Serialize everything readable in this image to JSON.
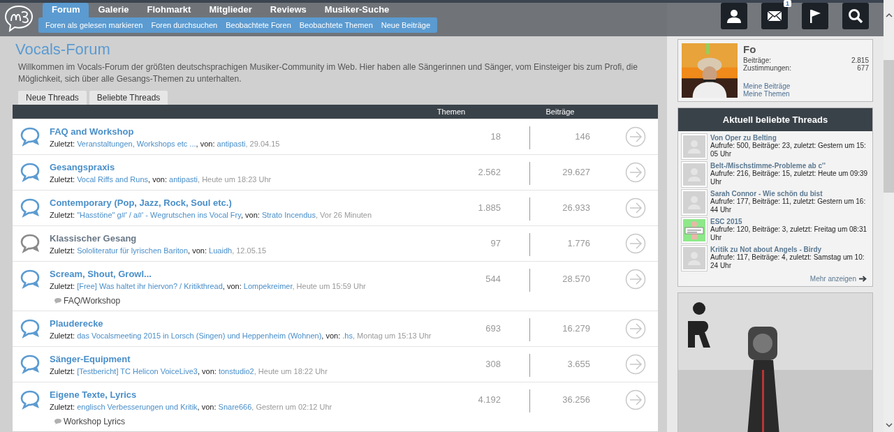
{
  "header": {
    "nav": [
      {
        "label": "Forum",
        "selected": true
      },
      {
        "label": "Galerie",
        "selected": false
      },
      {
        "label": "Flohmarkt",
        "selected": false
      },
      {
        "label": "Mitglieder",
        "selected": false
      },
      {
        "label": "Reviews",
        "selected": false
      },
      {
        "label": "Musiker-Suche",
        "selected": false
      }
    ],
    "subnav": [
      "Foren als gelesen markieren",
      "Foren durchsuchen",
      "Beobachtete Foren",
      "Beobachtete Themen",
      "Neue Beiträge"
    ],
    "mail_badge": "1"
  },
  "forum": {
    "title": "Vocals-Forum",
    "description": "Willkommen im Vocals-Forum der größten deutschsprachigen Musiker-Community im Web. Hier haben alle Sängerinnen und Sänger, vom Einsteiger bis zum Profi, die Möglichkeit, sich über alle Gesangs-Themen zu unterhalten.",
    "tabs": [
      {
        "label": "Neue Threads",
        "selected": false
      },
      {
        "label": "Beliebte Threads",
        "selected": false
      }
    ],
    "columns": [
      "Themen",
      "Beiträge"
    ],
    "rows": [
      {
        "title": "FAQ and Workshop",
        "unread": true,
        "last_post": [
          {
            "kind": "label",
            "text": "Zuletzt:"
          },
          {
            "kind": "thread",
            "text": "Veranstaltungen, Workshops etc ..."
          },
          {
            "kind": "label",
            "text": ", von:"
          },
          {
            "kind": "user",
            "text": "antipasti"
          },
          {
            "kind": "date",
            "text": ", 29.04.15"
          }
        ],
        "topics": "18",
        "posts": "146"
      },
      {
        "title": "Gesangspraxis",
        "unread": true,
        "last_post": [
          {
            "kind": "label",
            "text": "Zuletzt:"
          },
          {
            "kind": "thread",
            "text": "Vocal Riffs and Runs"
          },
          {
            "kind": "label",
            "text": ", von:"
          },
          {
            "kind": "user",
            "text": "antipasti"
          },
          {
            "kind": "date",
            "text": ", Heute um 18:23 Uhr"
          }
        ],
        "topics": "2.562",
        "posts": "29.627"
      },
      {
        "title": "Contemporary (Pop, Jazz, Rock, Soul etc.)",
        "unread": true,
        "last_post": [
          {
            "kind": "label",
            "text": "Zuletzt:"
          },
          {
            "kind": "thread",
            "text": "\"Hasstöne\" g#' / a#' - Wegrutschen ins Vocal Fry"
          },
          {
            "kind": "label",
            "text": ", von:"
          },
          {
            "kind": "user",
            "text": "Strato Incendus"
          },
          {
            "kind": "date",
            "text": ", Vor 26 Minuten"
          }
        ],
        "topics": "1.885",
        "posts": "26.933"
      },
      {
        "title": "Klassischer Gesang",
        "unread": false,
        "last_post": [
          {
            "kind": "label",
            "text": "Zuletzt:"
          },
          {
            "kind": "thread",
            "text": "Sololiteratur für lyrischen Bariton"
          },
          {
            "kind": "label",
            "text": ", von:"
          },
          {
            "kind": "user",
            "text": "Luaidh"
          },
          {
            "kind": "date",
            "text": ", 12.05.15"
          }
        ],
        "topics": "97",
        "posts": "1.776"
      },
      {
        "title": "Scream, Shout, Growl...",
        "unread": true,
        "last_post": [
          {
            "kind": "label",
            "text": "Zuletzt:"
          },
          {
            "kind": "thread",
            "text": "[Free] Was haltet ihr hiervon? / Kritikthread"
          },
          {
            "kind": "label",
            "text": ", von:"
          },
          {
            "kind": "user",
            "text": "Lompekreimer"
          },
          {
            "kind": "date",
            "text": ", Heute um 15:59 Uhr"
          }
        ],
        "topics": "544",
        "posts": "28.570",
        "subforums": [
          "FAQ/Workshop"
        ]
      },
      {
        "title": "Plauderecke",
        "unread": true,
        "last_post": [
          {
            "kind": "label",
            "text": "Zuletzt:"
          },
          {
            "kind": "thread",
            "text": "das Vocalsmeeting 2015 in Lorsch (Singen) und Heppenheim (Wohnen)"
          },
          {
            "kind": "label",
            "text": ", von:"
          },
          {
            "kind": "user",
            "text": ".hs"
          },
          {
            "kind": "date",
            "text": ", Montag um 15:13 Uhr"
          }
        ],
        "topics": "693",
        "posts": "16.279"
      },
      {
        "title": "Sänger-Equipment",
        "unread": true,
        "last_post": [
          {
            "kind": "label",
            "text": "Zuletzt:"
          },
          {
            "kind": "thread",
            "text": "[Testbericht] TC Helicon VoiceLive3"
          },
          {
            "kind": "label",
            "text": ", von:"
          },
          {
            "kind": "user",
            "text": "tonstudio2"
          },
          {
            "kind": "date",
            "text": ", Heute um 18:22 Uhr"
          }
        ],
        "topics": "308",
        "posts": "3.655"
      },
      {
        "title": "Eigene Texte, Lyrics",
        "unread": true,
        "last_post": [
          {
            "kind": "label",
            "text": "Zuletzt:"
          },
          {
            "kind": "thread",
            "text": "englisch Verbesserungen und Kritik"
          },
          {
            "kind": "label",
            "text": ", von:"
          },
          {
            "kind": "user",
            "text": "Snare666"
          },
          {
            "kind": "date",
            "text": ", Gestern um 02:12 Uhr"
          }
        ],
        "topics": "4.192",
        "posts": "36.256",
        "subforums": [
          "Workshop Lyrics"
        ]
      }
    ]
  },
  "sidebar": {
    "profile": {
      "name": "Fo",
      "stats": [
        {
          "label": "Beiträge:",
          "value": "2.815"
        },
        {
          "label": "Zustimmungen:",
          "value": "677"
        }
      ],
      "links": [
        "Meine Beiträge",
        "Meine Themen"
      ]
    },
    "popular": {
      "title": "Aktuell beliebte Threads",
      "items": [
        {
          "title": "Von Oper zu Belting",
          "info": "Aufrufe: 500, Beiträge: 23, zuletzt: Gestern um 15:05 Uhr",
          "kind": "placeholder"
        },
        {
          "title": "Belt-/Mischstimme-Probleme ab c''",
          "info": "Aufrufe: 216, Beiträge: 15, zuletzt: Heute um 09:39 Uhr",
          "kind": "placeholder"
        },
        {
          "title": "Sarah Connor - Wie schön du bist",
          "info": "Aufrufe: 177, Beiträge: 11, zuletzt: Gestern um 16:44 Uhr",
          "kind": "placeholder"
        },
        {
          "title": "ESC 2015",
          "info": "Aufrufe: 120, Beiträge: 3, zuletzt: Freitag um 08:31 Uhr",
          "kind": "picture"
        },
        {
          "title": "Kritik zu Not about Angels - Birdy",
          "info": "Aufrufe: 117, Beiträge: 4, zuletzt: Samstag um 10:24 Uhr",
          "kind": "placeholder"
        }
      ],
      "more": "Mehr anzeigen"
    }
  }
}
